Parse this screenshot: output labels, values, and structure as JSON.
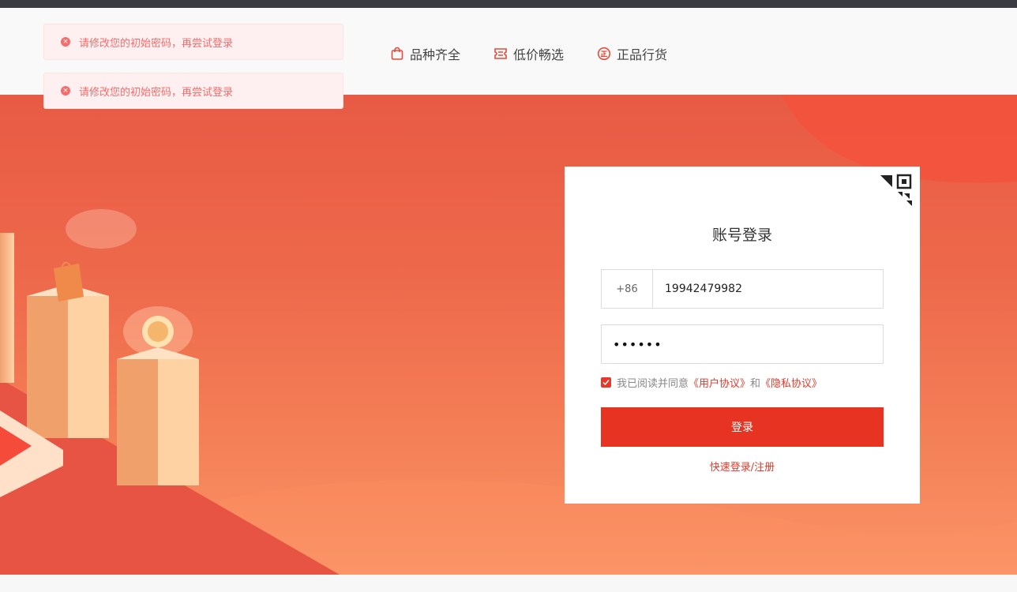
{
  "toasts": [
    {
      "message": "请修改您的初始密码，再尝试登录"
    },
    {
      "message": "请修改您的初始密码，再尝试登录"
    }
  ],
  "features": [
    {
      "label": "品种齐全",
      "icon": "shopping-bag-icon"
    },
    {
      "label": "低价畅选",
      "icon": "ticket-icon"
    },
    {
      "label": "正品行货",
      "icon": "genuine-badge-icon"
    }
  ],
  "login": {
    "title": "账号登录",
    "country_code": "+86",
    "phone_value": "19942479982",
    "password_masked": "••••••",
    "agreement_prefix": "我已阅读并同意",
    "user_agreement": "《用户协议》",
    "and_text": "和",
    "privacy_agreement": "《隐私协议》",
    "agreement_checked": true,
    "submit_label": "登录",
    "quick_login_label": "快速登录/注册"
  },
  "colors": {
    "accent": "#e63322",
    "error_text": "#f56c6c",
    "error_bg": "#fef0f0",
    "banner_top": "#e85a44",
    "banner_bottom": "#fb9467",
    "topbar": "#3a3b42"
  }
}
